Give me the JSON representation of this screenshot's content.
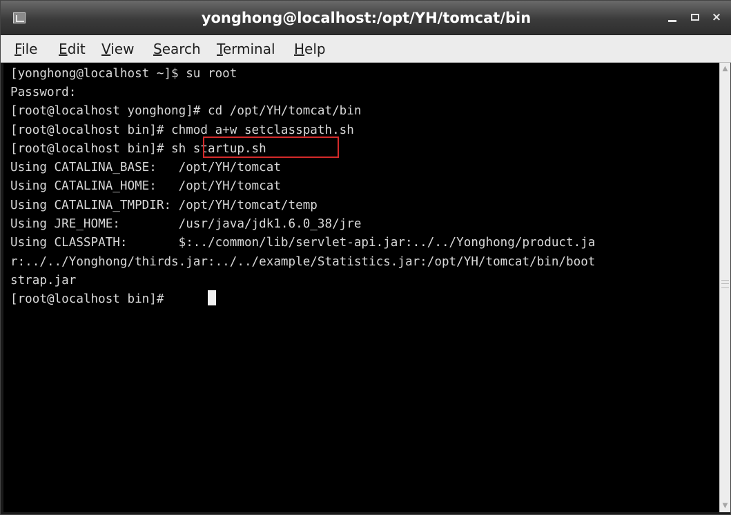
{
  "window": {
    "title": "yonghong@localhost:/opt/YH/tomcat/bin",
    "app_icon": "terminal-app-icon",
    "minimize_icon": "minimize-icon",
    "maximize_icon": "maximize-icon",
    "close_icon": "close-icon",
    "close_glyph": "×"
  },
  "menu": {
    "items": [
      "File",
      "Edit",
      "View",
      "Search",
      "Terminal",
      "Help"
    ]
  },
  "terminal": {
    "lines": [
      "[yonghong@localhost ~]$ su root",
      "Password:",
      "[root@localhost yonghong]# cd /opt/YH/tomcat/bin",
      "[root@localhost bin]# chmod a+w setclasspath.sh",
      "[root@localhost bin]# sh startup.sh",
      "Using CATALINA_BASE:   /opt/YH/tomcat",
      "Using CATALINA_HOME:   /opt/YH/tomcat",
      "Using CATALINA_TMPDIR: /opt/YH/tomcat/temp",
      "Using JRE_HOME:        /usr/java/jdk1.6.0_38/jre",
      "Using CLASSPATH:       $:../common/lib/servlet-api.jar:../../Yonghong/product.ja",
      "r:../../Yonghong/thirds.jar:../../example/Statistics.jar:/opt/YH/tomcat/bin/boot",
      "strap.jar",
      "[root@localhost bin]# "
    ],
    "highlighted_command": "sh startup.sh",
    "highlight_color": "#d42a2a",
    "background": "#000000",
    "foreground": "#d8d8d8"
  },
  "scrollbar": {
    "up_icon": "scroll-up-arrow-icon",
    "down_icon": "scroll-down-arrow-icon"
  }
}
